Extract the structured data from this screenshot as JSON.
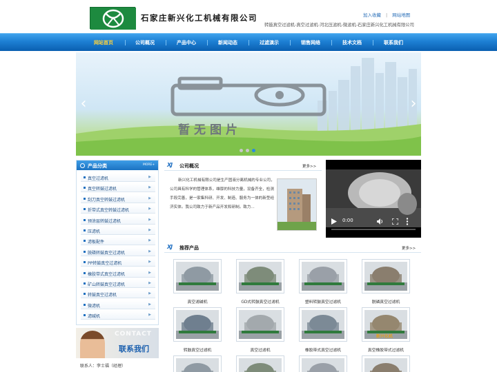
{
  "header": {
    "company_name": "石家庄新兴化工机械有限公司",
    "add_favorite": "加入收藏",
    "sitemap": "网站地图",
    "separator": "|",
    "tagline": "转鼓真空过滤机-真空过滤机-河北压滤机-微滤机-石家庄新兴化工机械有限公司"
  },
  "nav": {
    "items": [
      "网站首页",
      "公司概况",
      "产品中心",
      "新闻动态",
      "过滤演示",
      "销售网络",
      "技术文档",
      "联系我们"
    ],
    "active_index": 0
  },
  "banner": {
    "placeholder_text": "暂无图片",
    "prev_icon": "chevron-left-icon",
    "next_icon": "chevron-right-icon",
    "slide_count": 3,
    "active_slide": 3
  },
  "sidebar": {
    "title": "产品分类",
    "more": "MORE+",
    "categories": [
      "真空过滤机",
      "真空转鼓过滤机",
      "刮刀真空转鼓过滤机",
      "折带式真空转鼓过滤机",
      "预涂层转鼓过滤机",
      "压滤机",
      "滤板配件",
      "脱磷转鼓真空过滤机",
      "PP转鼓真空过滤机",
      "橡胶带式真空过滤机",
      "矿山转鼓真空过滤机",
      "转鼓真空过滤机",
      "微滤机",
      "滤碱机"
    ]
  },
  "contact": {
    "watermark": "CONTACT",
    "title": "联系我们",
    "person": "联系人：李士福（经理）"
  },
  "about": {
    "logo": "XJ",
    "title": "公司概况",
    "more": "更多>>",
    "text": "新兴化工机械有限公司是生产固液分离机械的专业公司，公司具有科学的管理体系，雄厚的科技力量，设备齐全，检测手段完善，是一家集科研、开发、制造、服务为一体的新型经济实体。我公司致力于新产品开发和研制。致力..."
  },
  "video": {
    "time": "0:00",
    "play_icon": "play-icon",
    "volume_icon": "volume-icon",
    "fullscreen_icon": "fullscreen-icon",
    "menu_icon": "more-vert-icon"
  },
  "products": {
    "logo": "XJ",
    "title": "推荐产品",
    "more": "更多>>",
    "items": [
      {
        "name": "真空滤碱机"
      },
      {
        "name": "GD式转鼓真空过滤机"
      },
      {
        "name": "塑料转鼓真空过滤机"
      },
      {
        "name": "脱磷真空过滤机"
      },
      {
        "name": "转鼓真空过滤机"
      },
      {
        "name": "真空过滤机"
      },
      {
        "name": "橡胶带式真空过滤机"
      },
      {
        "name": "真空橡胶带式过滤机"
      }
    ],
    "image_watermark": "新兴化机"
  },
  "colors": {
    "nav_blue": "#1d7fd3",
    "nav_active": "#ffd23a",
    "accent_blue": "#2a6fb8",
    "logo_green": "#1d8a3f"
  }
}
